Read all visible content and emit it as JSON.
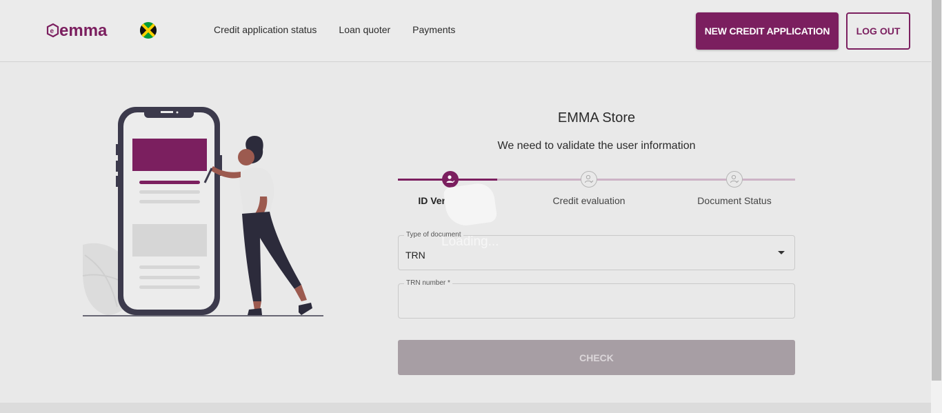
{
  "header": {
    "logo_text": "emma",
    "nav": [
      {
        "label": "Credit application status"
      },
      {
        "label": "Loan quoter"
      },
      {
        "label": "Payments"
      }
    ],
    "new_credit_label": "NEW CREDIT APPLICATION",
    "logout_label": "LOG OUT",
    "country_flag_icon": "jamaica-flag-icon"
  },
  "form": {
    "store_name": "EMMA Store",
    "subtitle": "We need to validate the user information",
    "steps": [
      {
        "label": "ID Verification",
        "state": "active"
      },
      {
        "label": "Credit evaluation",
        "state": "pending"
      },
      {
        "label": "Document Status",
        "state": "pending"
      }
    ],
    "loading_text": "Loading...",
    "document_type": {
      "label": "Type of document",
      "value": "TRN"
    },
    "trn_number": {
      "label": "TRN number *",
      "value": ""
    },
    "check_label": "CHECK"
  },
  "colors": {
    "brand": "#7b1f5f",
    "disabled_button": "#a79ea4",
    "background": "#e9e9e9"
  }
}
